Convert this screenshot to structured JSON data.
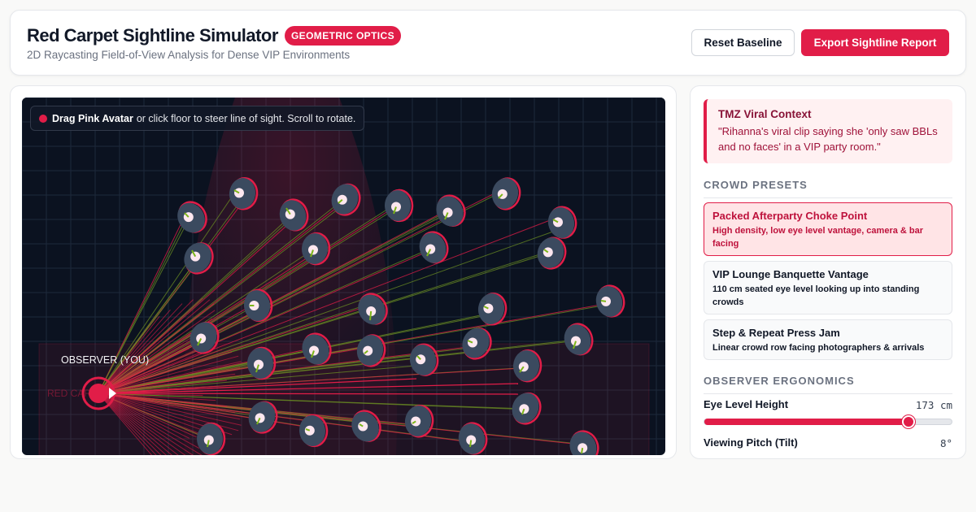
{
  "header": {
    "title": "Red Carpet Sightline Simulator",
    "badge": "GEOMETRIC OPTICS",
    "subtitle": "2D Raycasting Field-of-View Analysis for Dense VIP Environments",
    "reset_label": "Reset Baseline",
    "export_label": "Export Sightline Report"
  },
  "simulation": {
    "hint_bold": "Drag Pink Avatar",
    "hint_rest": "or click floor to steer line of sight. Scroll to rotate.",
    "observer_label": "OBSERVER (YOU)",
    "zone_label": "RED CARPET"
  },
  "context": {
    "title": "TMZ Viral Context",
    "quote": "\"Rihanna's viral clip saying she 'only saw BBLs and no faces' in a VIP party room.\""
  },
  "crowd_presets": {
    "heading": "CROWD PRESETS",
    "items": [
      {
        "name": "Packed Afterparty Choke Point",
        "desc": "High density, low eye level vantage, camera & bar facing",
        "active": true
      },
      {
        "name": "VIP Lounge Banquette Vantage",
        "desc": "110 cm seated eye level looking up into standing crowds",
        "active": false
      },
      {
        "name": "Step & Repeat Press Jam",
        "desc": "Linear crowd row facing photographers & arrivals",
        "active": false
      }
    ]
  },
  "ergonomics": {
    "heading": "OBSERVER ERGONOMICS",
    "eye_label": "Eye Level Height",
    "eye_value": "173 cm",
    "eye_fraction": 0.825,
    "pitch_label": "Viewing Pitch (Tilt)",
    "pitch_value": "8°"
  },
  "colors": {
    "accent": "#e11d48",
    "canvas_bg": "#0b1220",
    "person_body": "#3b4a5f",
    "ray_hit": "#6b8e23",
    "ray_miss": "#e11d48"
  }
}
